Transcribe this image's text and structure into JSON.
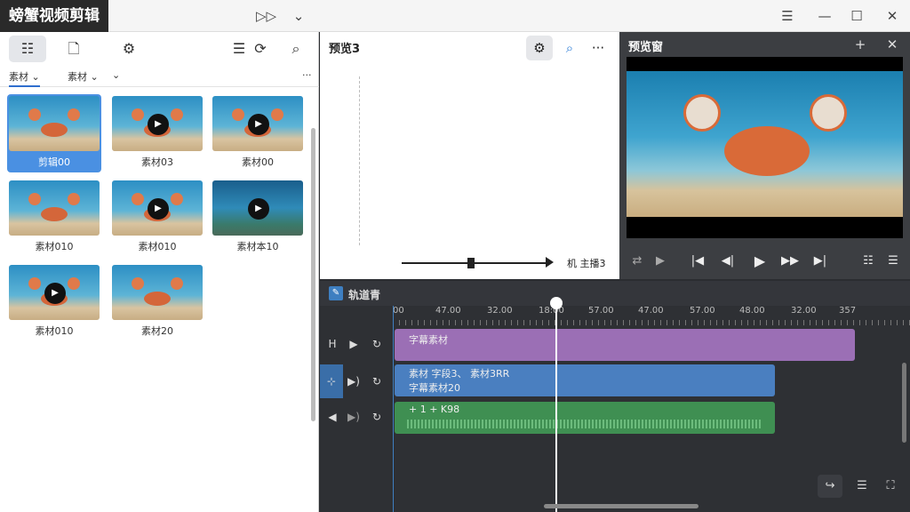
{
  "app": {
    "title": "螃蟹视频剪辑"
  },
  "titlebar_icons": [
    "forward-icon",
    "chevron-down-icon",
    "menu-icon",
    "minimize-icon",
    "maximize-icon",
    "close-icon"
  ],
  "media_panel": {
    "toolbar_icons": [
      "list-view-icon",
      "export-file-icon",
      "settings-gear-icon",
      "sort-list-icon",
      "sync-settings-icon",
      "zoom-icon"
    ],
    "tabs": [
      {
        "label": "素材"
      },
      {
        "label": "素材"
      }
    ],
    "more_label": "···",
    "clips": [
      {
        "label": "剪辑00",
        "selected": true,
        "play": false,
        "scene": "sand"
      },
      {
        "label": "素材03",
        "selected": false,
        "play": true,
        "scene": "sand"
      },
      {
        "label": "素材00",
        "selected": false,
        "play": true,
        "scene": "sand"
      },
      {
        "label": "素材010",
        "selected": false,
        "play": false,
        "scene": "sand"
      },
      {
        "label": "素材010",
        "selected": false,
        "play": true,
        "scene": "sand"
      },
      {
        "label": "素材本10",
        "selected": false,
        "play": true,
        "scene": "ocean"
      },
      {
        "label": "素材010",
        "selected": false,
        "play": true,
        "scene": "sand"
      },
      {
        "label": "素材20",
        "selected": false,
        "play": false,
        "scene": "sand"
      }
    ]
  },
  "preview_panel": {
    "title": "预览3",
    "icons": [
      "gear-icon",
      "search-icon",
      "more-icon"
    ],
    "slider_label": "机 主播3"
  },
  "player": {
    "title": "预览窗",
    "controls": [
      "shuffle-icon",
      "play-small-icon",
      "skip-start-icon",
      "step-back-icon",
      "play-icon",
      "fast-forward-icon",
      "skip-end-icon",
      "list-icon",
      "menu-icon"
    ]
  },
  "timeline": {
    "title": "轨道青",
    "ticks": [
      "00",
      "47.00",
      "32.00",
      "18:00",
      "57.00",
      "47.00",
      "57.00",
      "48.00",
      "32.00",
      "357"
    ],
    "tracks": [
      {
        "name": "title-track",
        "label": "字幕素材",
        "color": "#9b6fb5"
      },
      {
        "name": "video-track",
        "label": "素材 字段3、 素材3RR",
        "sub_label": "字幕素材20",
        "color": "#4a7fc0"
      },
      {
        "name": "audio-track",
        "label": "+ 1 + K98",
        "color": "#3f8f52"
      }
    ],
    "progress": 0.29
  }
}
